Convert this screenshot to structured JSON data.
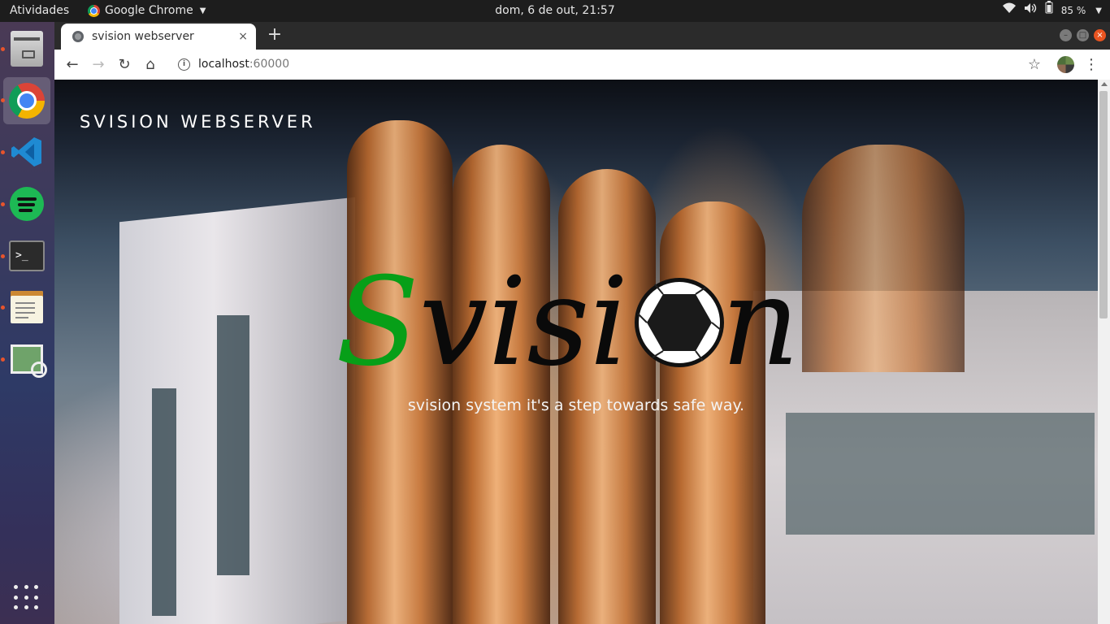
{
  "topbar": {
    "activities": "Atividades",
    "app_name": "Google Chrome",
    "clock": "dom,  6 de out, 21:57",
    "battery": "85 %"
  },
  "dock": {
    "items": [
      "files-icon",
      "chrome-icon",
      "vscode-icon",
      "spotify-icon",
      "terminal-icon",
      "text-editor-icon",
      "image-viewer-icon"
    ],
    "terminal_prompt": ">_"
  },
  "browser": {
    "tab_title": "svision webserver",
    "tab_close": "×",
    "new_tab": "+",
    "url_host": "localhost",
    "url_port": ":60000"
  },
  "page": {
    "brand": "SVISION WEBSERVER",
    "logo_s": "S",
    "logo_vis": "visi",
    "logo_n": "n",
    "tagline": "svision system it's a step towards safe way."
  },
  "colors": {
    "logo_s": "#079f18",
    "topbar_bg": "#1d1d1d",
    "close_button": "#e95420"
  }
}
